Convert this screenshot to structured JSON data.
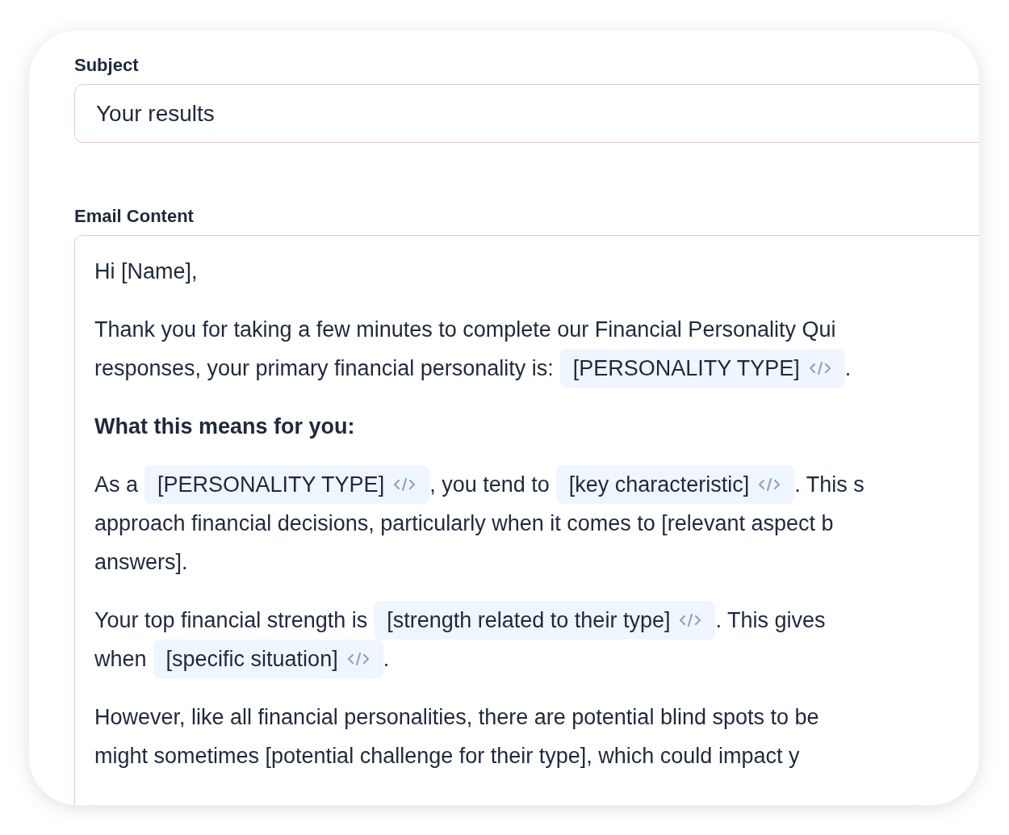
{
  "subject": {
    "label": "Subject",
    "value": "Your results"
  },
  "email_content": {
    "label": "Email Content",
    "paragraphs": [
      {
        "kind": "text",
        "lines": [
          [
            {
              "kind": "text",
              "text": "Hi [Name],"
            }
          ]
        ]
      },
      {
        "kind": "text",
        "lines": [
          [
            {
              "kind": "text",
              "text": "Thank you for taking a few minutes to complete our Financial Personality Qui"
            }
          ],
          [
            {
              "kind": "text",
              "text": "responses, your primary financial personality is:"
            },
            {
              "kind": "variable",
              "text": "[PERSONALITY TYPE]"
            },
            {
              "kind": "text",
              "text": "."
            }
          ]
        ]
      },
      {
        "kind": "heading",
        "lines": [
          [
            {
              "kind": "text",
              "text": "What this means for you:"
            }
          ]
        ]
      },
      {
        "kind": "text",
        "lines": [
          [
            {
              "kind": "text",
              "text": "As a"
            },
            {
              "kind": "variable",
              "text": "[PERSONALITY TYPE]"
            },
            {
              "kind": "text",
              "text": ", you tend to"
            },
            {
              "kind": "variable",
              "text": "[key characteristic]"
            },
            {
              "kind": "text",
              "text": ". This s"
            }
          ],
          [
            {
              "kind": "text",
              "text": "approach financial decisions, particularly when it comes to [relevant aspect b"
            }
          ],
          [
            {
              "kind": "text",
              "text": "answers]."
            }
          ]
        ]
      },
      {
        "kind": "text",
        "lines": [
          [
            {
              "kind": "text",
              "text": "Your top financial strength is"
            },
            {
              "kind": "variable",
              "text": "[strength related to their type]"
            },
            {
              "kind": "text",
              "text": ". This gives"
            }
          ],
          [
            {
              "kind": "text",
              "text": "when"
            },
            {
              "kind": "variable",
              "text": "[specific situation]"
            },
            {
              "kind": "text",
              "text": "."
            }
          ]
        ]
      },
      {
        "kind": "text",
        "lines": [
          [
            {
              "kind": "text",
              "text": "However, like all financial personalities, there are potential blind spots to be"
            }
          ],
          [
            {
              "kind": "text",
              "text": "might sometimes [potential challenge for their type], which could impact y"
            }
          ]
        ]
      }
    ]
  }
}
